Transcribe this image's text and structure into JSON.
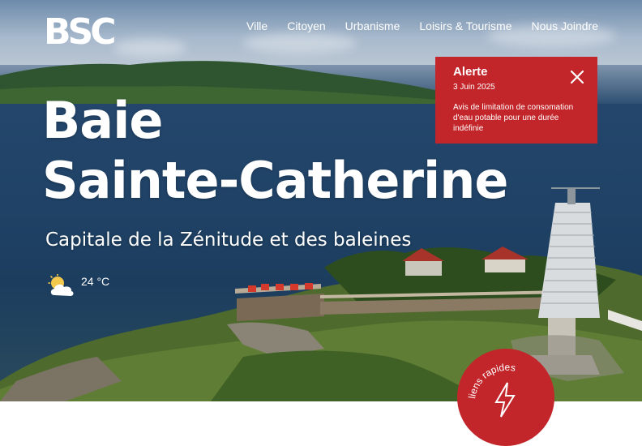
{
  "site": {
    "logo_text": "BSC",
    "colors": {
      "accent": "#c2262a",
      "text": "#ffffff"
    }
  },
  "nav": {
    "items": [
      {
        "label": "Ville"
      },
      {
        "label": "Citoyen"
      },
      {
        "label": "Urbanisme"
      },
      {
        "label": "Loisirs & Tourisme"
      },
      {
        "label": "Nous Joindre"
      }
    ]
  },
  "alert": {
    "title": "Alerte",
    "date": "3 Juin 2025",
    "message": "Avis de limitation de consomation d'eau potable pour une durée indéfinie",
    "close_icon": "close-icon"
  },
  "hero": {
    "title_line1": "Baie",
    "title_line2": "Sainte-Catherine",
    "subtitle": "Capitale de la Zénitude et des baleines"
  },
  "weather": {
    "icon": "partly-cloudy-icon",
    "temperature": "24 °C"
  },
  "quick_links": {
    "label": "liens rapides",
    "icon": "lightning-icon"
  }
}
